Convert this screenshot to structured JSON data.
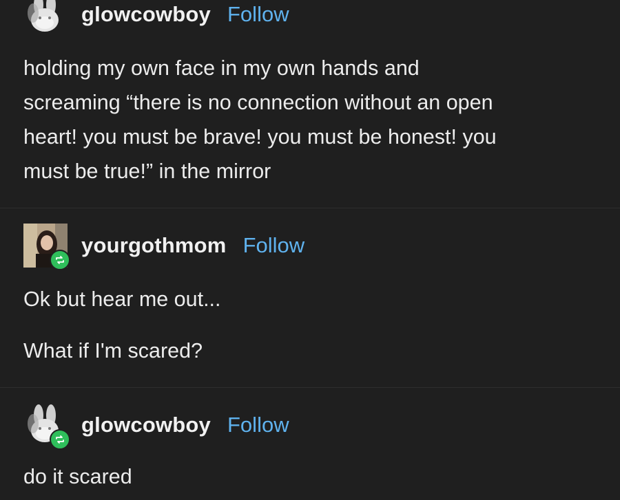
{
  "posts": [
    {
      "username": "glowcowboy",
      "follow_label": "Follow",
      "avatar_icon": "bunny-avatar",
      "reblogged": false,
      "lines": [
        "holding my own face in my own hands and",
        "screaming “there is no connection without an open",
        "heart! you must be brave! you must be honest! you",
        "must be true!” in the mirror"
      ]
    },
    {
      "username": "yourgothmom",
      "follow_label": "Follow",
      "avatar_icon": "photo-avatar",
      "reblogged": true,
      "paragraphs": [
        "Ok but hear me out...",
        "What if I'm scared?"
      ]
    },
    {
      "username": "glowcowboy",
      "follow_label": "Follow",
      "avatar_icon": "bunny-avatar",
      "reblogged": true,
      "paragraphs": [
        "do it scared"
      ]
    }
  ],
  "colors": {
    "background": "#1f1f1f",
    "follow": "#5fb2ee",
    "reblog_badge": "#2fbe5b",
    "divider": "#2e2e2e"
  }
}
